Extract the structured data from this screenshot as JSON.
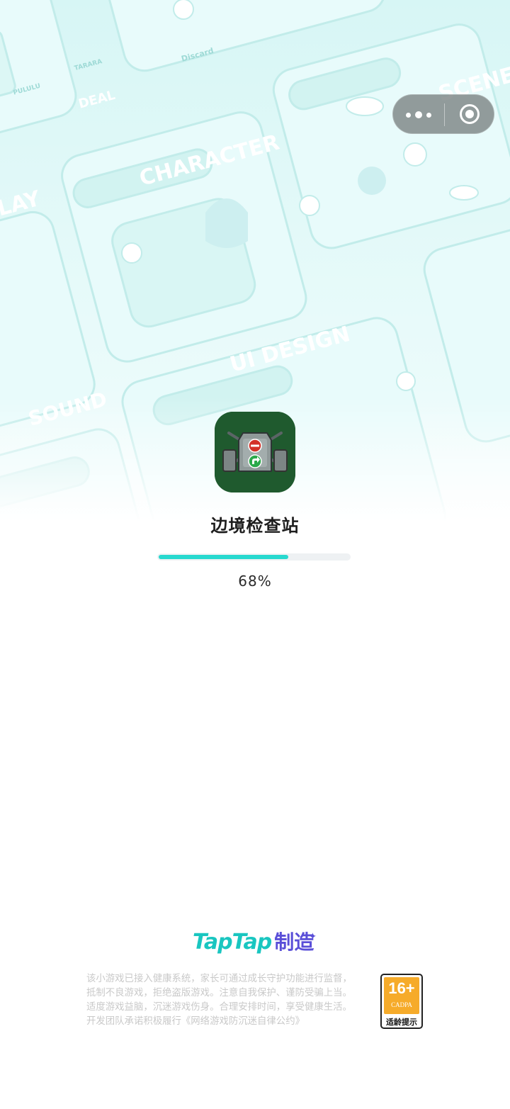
{
  "background": {
    "labels": [
      "CHARACTER",
      "SCENE",
      "UI DESIGN",
      "SOUND",
      "LAY",
      "DEAL",
      "Discard",
      "PULULU",
      "TARARA"
    ]
  },
  "capsule": {
    "more_icon": "more-dots-icon",
    "close_icon": "close-circle-icon"
  },
  "app": {
    "title": "边境检查站",
    "icon": "border-checkpoint-app-icon"
  },
  "progress": {
    "value": 0.68,
    "text": "68%",
    "fill_color": "#27d9cf"
  },
  "footer": {
    "brand_tap": "TapTap",
    "brand_zao": "制造",
    "notice_lines": [
      "该小游戏已接入健康系统，家长可通过成长守护功能进行监督，",
      "抵制不良游戏，拒绝盗版游戏。注意自我保护、谨防受骗上当。",
      "适度游戏益脑，沉迷游戏伤身。合理安排时间，享受健康生活。",
      "开发团队承诺积极履行《网络游戏防沉迷自律公约》"
    ],
    "age_rating": {
      "age": "16+",
      "org": "CADPA",
      "tip": "适龄提示"
    }
  }
}
